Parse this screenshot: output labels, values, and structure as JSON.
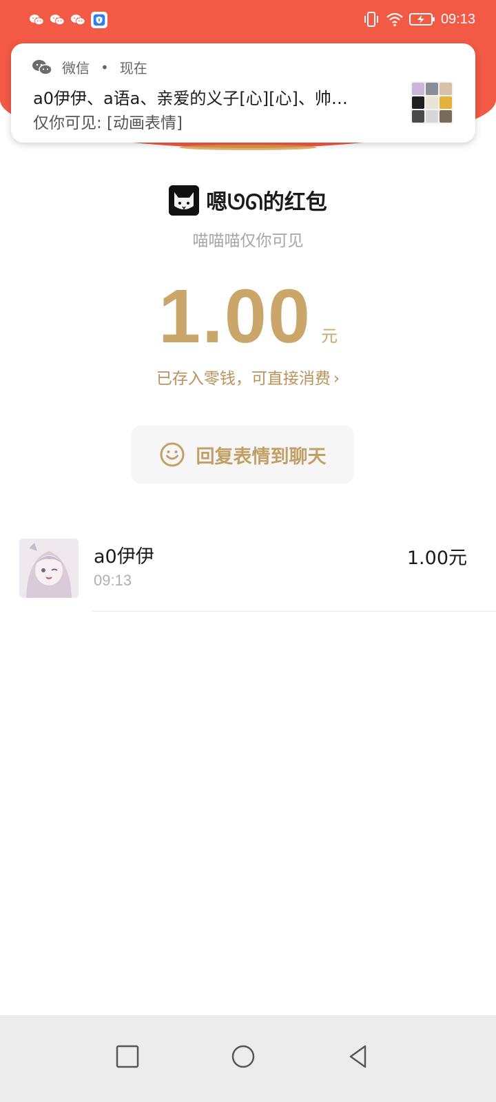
{
  "status_bar": {
    "time": "09:13",
    "left_icons": [
      "wechat-icon",
      "wechat-icon",
      "wechat-icon",
      "shield-icon"
    ],
    "right_icons": [
      "vibrate-icon",
      "wifi-icon",
      "battery-charging-icon"
    ]
  },
  "notification": {
    "app_name": "微信",
    "separator": "•",
    "time": "现在",
    "title": "a0伊伊、a语a、亲爱的义子[心][心]、帅…",
    "body": "仅你可见: [动画表情]"
  },
  "red_packet": {
    "sender_name": "嗯ᘎᘏ的红包",
    "blessing": "喵喵喵仅你可见",
    "amount": "1.00",
    "unit": "元",
    "stored_text": "已存入零钱，可直接消费",
    "stored_chevron": "›",
    "reply_button_label": "回复表情到聊天"
  },
  "receivers": [
    {
      "name": "a0伊伊",
      "time": "09:13",
      "amount": "1.00元"
    }
  ],
  "colors": {
    "header_red": "#f25a45",
    "gold": "#caa66a",
    "gold_dark": "#b8925a"
  }
}
